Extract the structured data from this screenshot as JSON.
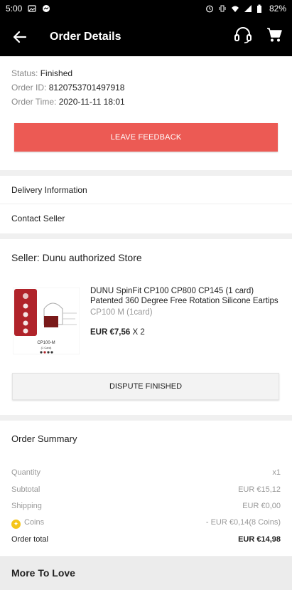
{
  "status_bar": {
    "time": "5:00",
    "battery": "82%"
  },
  "header": {
    "title": "Order Details"
  },
  "order": {
    "status_label": "Status:",
    "status_value": "Finished",
    "id_label": "Order ID:",
    "id_value": "8120753701497918",
    "time_label": "Order Time:",
    "time_value": "2020-11-11 18:01",
    "feedback_button": "LEAVE FEEDBACK"
  },
  "links": {
    "delivery": "Delivery Information",
    "contact": "Contact Seller"
  },
  "seller": {
    "name": "Seller: Dunu authorized Store",
    "product": {
      "title_line1": "DUNU SpinFit CP100 CP800 CP145 (1 card)",
      "title_line2": "Patented 360 Degree Free Rotation Silicone Eartips",
      "variant": "CP100 M (1card)",
      "price": "EUR €7,56",
      "qty": "X 2",
      "thumb_caption": "CP100-M",
      "thumb_sub": "(1 Card)"
    },
    "dispute_button": "DISPUTE FINISHED"
  },
  "summary": {
    "title": "Order Summary",
    "quantity_label": "Quantity",
    "quantity_value": "x1",
    "subtotal_label": "Subtotal",
    "subtotal_value": "EUR €15,12",
    "shipping_label": "Shipping",
    "shipping_value": "EUR €0,00",
    "coins_label": "Coins",
    "coins_value": "- EUR €0,14(8 Coins)",
    "total_label": "Order total",
    "total_value": "EUR €14,98"
  },
  "more": {
    "title": "More To Love"
  },
  "colors": {
    "accent": "#ec5a54",
    "coin": "#f5c518"
  }
}
